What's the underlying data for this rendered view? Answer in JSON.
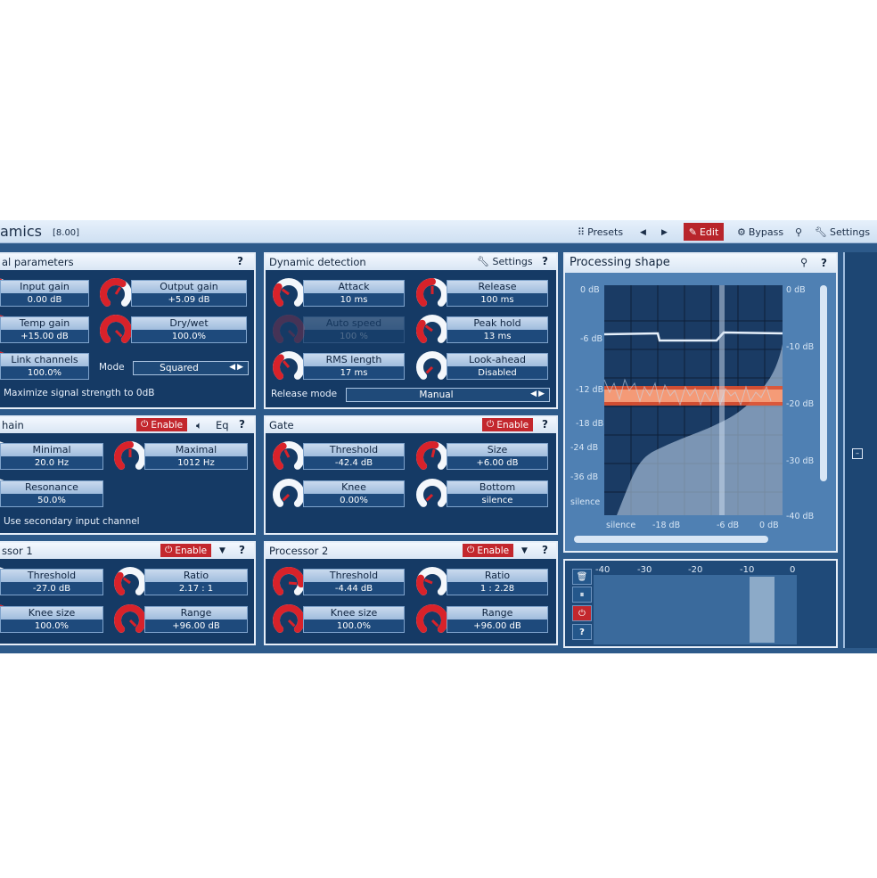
{
  "titlebar": {
    "title": "amics",
    "version": "[8.00]",
    "presets": "Presets",
    "prev": "◀",
    "next": "▶",
    "edit": "Edit",
    "bypass": "Bypass",
    "settings": "Settings"
  },
  "global": {
    "title": "al parameters",
    "help": "?",
    "input_gain": {
      "label": "Input gain",
      "value": "0.00 dB"
    },
    "output_gain": {
      "label": "Output gain",
      "value": "+5.09 dB"
    },
    "temp_gain": {
      "label": "Temp gain",
      "value": "+15.00 dB"
    },
    "dry_wet": {
      "label": "Dry/wet",
      "value": "100.0%"
    },
    "link_channels": {
      "label": "Link channels",
      "value": "100.0%"
    },
    "mode_label": "Mode",
    "mode_value": "Squared",
    "maximize": "Maximize signal strength to 0dB"
  },
  "detection": {
    "title": "Dynamic detection",
    "settings": "Settings",
    "help": "?",
    "attack": {
      "label": "Attack",
      "value": "10 ms"
    },
    "release": {
      "label": "Release",
      "value": "100 ms"
    },
    "auto_speed": {
      "label": "Auto speed",
      "value": "100 %"
    },
    "peak_hold": {
      "label": "Peak hold",
      "value": "13 ms"
    },
    "rms_length": {
      "label": "RMS length",
      "value": "17 ms"
    },
    "look_ahead": {
      "label": "Look-ahead",
      "value": "Disabled"
    },
    "release_mode_label": "Release mode",
    "release_mode_value": "Manual"
  },
  "sidechain": {
    "title": "hain",
    "enable": "Enable",
    "eq": "Eq",
    "help": "?",
    "minimal": {
      "label": "Minimal",
      "value": "20.0 Hz"
    },
    "maximal": {
      "label": "Maximal",
      "value": "1012 Hz"
    },
    "resonance": {
      "label": "Resonance",
      "value": "50.0%"
    },
    "secondary": "Use secondary input channel"
  },
  "gate": {
    "title": "Gate",
    "enable": "Enable",
    "help": "?",
    "threshold": {
      "label": "Threshold",
      "value": "-42.4 dB"
    },
    "size": {
      "label": "Size",
      "value": "+6.00 dB"
    },
    "knee": {
      "label": "Knee",
      "value": "0.00%"
    },
    "bottom": {
      "label": "Bottom",
      "value": "silence"
    }
  },
  "proc1": {
    "title": "ssor 1",
    "enable": "Enable",
    "help": "?",
    "threshold": {
      "label": "Threshold",
      "value": "-27.0 dB"
    },
    "ratio": {
      "label": "Ratio",
      "value": "2.17 : 1"
    },
    "knee": {
      "label": "Knee size",
      "value": "100.0%"
    },
    "range": {
      "label": "Range",
      "value": "+96.00 dB"
    }
  },
  "proc2": {
    "title": "Processor 2",
    "enable": "Enable",
    "help": "?",
    "threshold": {
      "label": "Threshold",
      "value": "-4.44 dB"
    },
    "ratio": {
      "label": "Ratio",
      "value": "1 : 2.28"
    },
    "knee": {
      "label": "Knee size",
      "value": "100.0%"
    },
    "range": {
      "label": "Range",
      "value": "+96.00 dB"
    }
  },
  "shape": {
    "title": "Processing shape",
    "help": "?",
    "left_axis": [
      "0 dB",
      "-6 dB",
      "-12 dB",
      "-18 dB",
      "-24 dB",
      "-36 dB",
      "silence"
    ],
    "right_axis": [
      "0 dB",
      "-10 dB",
      "-20 dB",
      "-30 dB",
      "-40 dB"
    ],
    "bottom_axis": [
      "silence",
      "-18 dB",
      "-6 dB",
      "0 dB"
    ]
  },
  "meter": {
    "scale": [
      "-40",
      "-30",
      "-20",
      "-10",
      "0"
    ],
    "help": "?"
  },
  "knobs": {
    "input_gain": 0.55,
    "output_gain": 0.62,
    "temp_gain": 0.75,
    "dry_wet": 1.0,
    "link_channels": 1.0,
    "attack": 0.3,
    "release": 0.5,
    "auto_speed": 1.0,
    "peak_hold": 0.3,
    "rms_length": 0.35,
    "look_ahead": 0.0,
    "minimal": 0.0,
    "maximal": 0.5,
    "resonance": 0.5,
    "gate_threshold": 0.4,
    "gate_size": 0.55,
    "gate_knee": 0.0,
    "gate_bottom": 0.0,
    "p1_threshold": 0.0,
    "p1_ratio": 0.3,
    "p1_knee": 1.0,
    "p1_range": 1.0,
    "p2_threshold": 0.85,
    "p2_ratio": 0.25,
    "p2_knee": 1.0,
    "p2_range": 1.0
  },
  "colors": {
    "accent": "#c3272d",
    "panel": "#153a65",
    "header": "#e6f0fb"
  }
}
